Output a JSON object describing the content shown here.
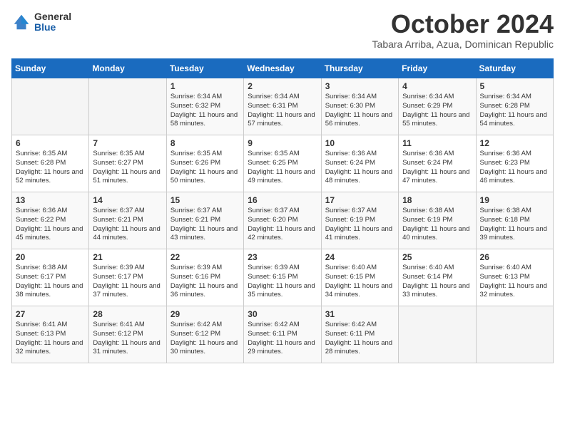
{
  "logo": {
    "general": "General",
    "blue": "Blue"
  },
  "title": "October 2024",
  "location": "Tabara Arriba, Azua, Dominican Republic",
  "days_of_week": [
    "Sunday",
    "Monday",
    "Tuesday",
    "Wednesday",
    "Thursday",
    "Friday",
    "Saturday"
  ],
  "weeks": [
    [
      {
        "day": "",
        "sunrise": "",
        "sunset": "",
        "daylight": ""
      },
      {
        "day": "",
        "sunrise": "",
        "sunset": "",
        "daylight": ""
      },
      {
        "day": "1",
        "sunrise": "Sunrise: 6:34 AM",
        "sunset": "Sunset: 6:32 PM",
        "daylight": "Daylight: 11 hours and 58 minutes."
      },
      {
        "day": "2",
        "sunrise": "Sunrise: 6:34 AM",
        "sunset": "Sunset: 6:31 PM",
        "daylight": "Daylight: 11 hours and 57 minutes."
      },
      {
        "day": "3",
        "sunrise": "Sunrise: 6:34 AM",
        "sunset": "Sunset: 6:30 PM",
        "daylight": "Daylight: 11 hours and 56 minutes."
      },
      {
        "day": "4",
        "sunrise": "Sunrise: 6:34 AM",
        "sunset": "Sunset: 6:29 PM",
        "daylight": "Daylight: 11 hours and 55 minutes."
      },
      {
        "day": "5",
        "sunrise": "Sunrise: 6:34 AM",
        "sunset": "Sunset: 6:28 PM",
        "daylight": "Daylight: 11 hours and 54 minutes."
      }
    ],
    [
      {
        "day": "6",
        "sunrise": "Sunrise: 6:35 AM",
        "sunset": "Sunset: 6:28 PM",
        "daylight": "Daylight: 11 hours and 52 minutes."
      },
      {
        "day": "7",
        "sunrise": "Sunrise: 6:35 AM",
        "sunset": "Sunset: 6:27 PM",
        "daylight": "Daylight: 11 hours and 51 minutes."
      },
      {
        "day": "8",
        "sunrise": "Sunrise: 6:35 AM",
        "sunset": "Sunset: 6:26 PM",
        "daylight": "Daylight: 11 hours and 50 minutes."
      },
      {
        "day": "9",
        "sunrise": "Sunrise: 6:35 AM",
        "sunset": "Sunset: 6:25 PM",
        "daylight": "Daylight: 11 hours and 49 minutes."
      },
      {
        "day": "10",
        "sunrise": "Sunrise: 6:36 AM",
        "sunset": "Sunset: 6:24 PM",
        "daylight": "Daylight: 11 hours and 48 minutes."
      },
      {
        "day": "11",
        "sunrise": "Sunrise: 6:36 AM",
        "sunset": "Sunset: 6:24 PM",
        "daylight": "Daylight: 11 hours and 47 minutes."
      },
      {
        "day": "12",
        "sunrise": "Sunrise: 6:36 AM",
        "sunset": "Sunset: 6:23 PM",
        "daylight": "Daylight: 11 hours and 46 minutes."
      }
    ],
    [
      {
        "day": "13",
        "sunrise": "Sunrise: 6:36 AM",
        "sunset": "Sunset: 6:22 PM",
        "daylight": "Daylight: 11 hours and 45 minutes."
      },
      {
        "day": "14",
        "sunrise": "Sunrise: 6:37 AM",
        "sunset": "Sunset: 6:21 PM",
        "daylight": "Daylight: 11 hours and 44 minutes."
      },
      {
        "day": "15",
        "sunrise": "Sunrise: 6:37 AM",
        "sunset": "Sunset: 6:21 PM",
        "daylight": "Daylight: 11 hours and 43 minutes."
      },
      {
        "day": "16",
        "sunrise": "Sunrise: 6:37 AM",
        "sunset": "Sunset: 6:20 PM",
        "daylight": "Daylight: 11 hours and 42 minutes."
      },
      {
        "day": "17",
        "sunrise": "Sunrise: 6:37 AM",
        "sunset": "Sunset: 6:19 PM",
        "daylight": "Daylight: 11 hours and 41 minutes."
      },
      {
        "day": "18",
        "sunrise": "Sunrise: 6:38 AM",
        "sunset": "Sunset: 6:19 PM",
        "daylight": "Daylight: 11 hours and 40 minutes."
      },
      {
        "day": "19",
        "sunrise": "Sunrise: 6:38 AM",
        "sunset": "Sunset: 6:18 PM",
        "daylight": "Daylight: 11 hours and 39 minutes."
      }
    ],
    [
      {
        "day": "20",
        "sunrise": "Sunrise: 6:38 AM",
        "sunset": "Sunset: 6:17 PM",
        "daylight": "Daylight: 11 hours and 38 minutes."
      },
      {
        "day": "21",
        "sunrise": "Sunrise: 6:39 AM",
        "sunset": "Sunset: 6:17 PM",
        "daylight": "Daylight: 11 hours and 37 minutes."
      },
      {
        "day": "22",
        "sunrise": "Sunrise: 6:39 AM",
        "sunset": "Sunset: 6:16 PM",
        "daylight": "Daylight: 11 hours and 36 minutes."
      },
      {
        "day": "23",
        "sunrise": "Sunrise: 6:39 AM",
        "sunset": "Sunset: 6:15 PM",
        "daylight": "Daylight: 11 hours and 35 minutes."
      },
      {
        "day": "24",
        "sunrise": "Sunrise: 6:40 AM",
        "sunset": "Sunset: 6:15 PM",
        "daylight": "Daylight: 11 hours and 34 minutes."
      },
      {
        "day": "25",
        "sunrise": "Sunrise: 6:40 AM",
        "sunset": "Sunset: 6:14 PM",
        "daylight": "Daylight: 11 hours and 33 minutes."
      },
      {
        "day": "26",
        "sunrise": "Sunrise: 6:40 AM",
        "sunset": "Sunset: 6:13 PM",
        "daylight": "Daylight: 11 hours and 32 minutes."
      }
    ],
    [
      {
        "day": "27",
        "sunrise": "Sunrise: 6:41 AM",
        "sunset": "Sunset: 6:13 PM",
        "daylight": "Daylight: 11 hours and 32 minutes."
      },
      {
        "day": "28",
        "sunrise": "Sunrise: 6:41 AM",
        "sunset": "Sunset: 6:12 PM",
        "daylight": "Daylight: 11 hours and 31 minutes."
      },
      {
        "day": "29",
        "sunrise": "Sunrise: 6:42 AM",
        "sunset": "Sunset: 6:12 PM",
        "daylight": "Daylight: 11 hours and 30 minutes."
      },
      {
        "day": "30",
        "sunrise": "Sunrise: 6:42 AM",
        "sunset": "Sunset: 6:11 PM",
        "daylight": "Daylight: 11 hours and 29 minutes."
      },
      {
        "day": "31",
        "sunrise": "Sunrise: 6:42 AM",
        "sunset": "Sunset: 6:11 PM",
        "daylight": "Daylight: 11 hours and 28 minutes."
      },
      {
        "day": "",
        "sunrise": "",
        "sunset": "",
        "daylight": ""
      },
      {
        "day": "",
        "sunrise": "",
        "sunset": "",
        "daylight": ""
      }
    ]
  ]
}
